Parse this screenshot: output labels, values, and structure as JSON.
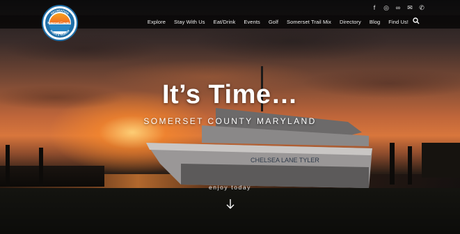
{
  "social": {
    "icons": [
      "facebook-icon",
      "instagram-icon",
      "tripadvisor-icon",
      "email-icon",
      "phone-icon"
    ],
    "glyphs": [
      "f",
      "◎",
      "∞",
      "✉",
      "✆"
    ]
  },
  "nav": {
    "items": [
      "Explore",
      "Stay With Us",
      "Eat/Drink",
      "Events",
      "Golf",
      "Somerset Trail Mix",
      "Directory",
      "Blog",
      "Find Us!"
    ],
    "search_icon": "search-icon"
  },
  "logo": {
    "text_top": "RECREATION",
    "text_mid": "Somerset County",
    "text_bottom": "PARKS & TOURISM"
  },
  "hero": {
    "headline": "It’s Time…",
    "subhead": "SOMERSET COUNTY MARYLAND",
    "cta": "enjoy today",
    "boat_name": "CHELSEA LANE TYLER"
  },
  "colors": {
    "accent": "#1f6fa8",
    "sun": "#f5a020"
  }
}
